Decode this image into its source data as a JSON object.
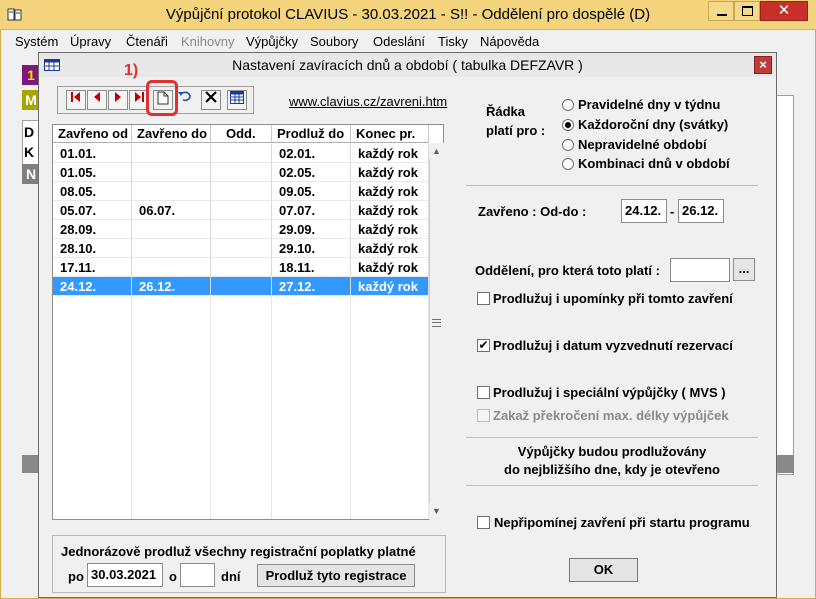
{
  "window": {
    "title": "Výpůjční protokol CLAVIUS - 30.03.2021 - S!! - Oddělení pro dospělé (D)"
  },
  "menu": [
    {
      "label": "Systém",
      "enabled": true
    },
    {
      "label": "Úpravy",
      "enabled": true
    },
    {
      "label": "Čtenáři",
      "enabled": true
    },
    {
      "label": "Knihovny",
      "enabled": false
    },
    {
      "label": "Výpůjčky",
      "enabled": true
    },
    {
      "label": "Soubory",
      "enabled": true
    },
    {
      "label": "Odeslání",
      "enabled": true
    },
    {
      "label": "Tisky",
      "enabled": true
    },
    {
      "label": "Nápověda",
      "enabled": true
    }
  ],
  "background_strip": [
    "1",
    "M",
    "D",
    "K",
    "N"
  ],
  "dialog": {
    "title": "Nastavení zavíracích dnů a období ( tabulka DEFZAVR )",
    "close": "×",
    "annotation": "1)",
    "link": "www.clavius.cz/zavreni.htm",
    "toolbar": [
      "first-record-icon",
      "prev-record-icon",
      "next-record-icon",
      "last-record-icon",
      "new-record-icon",
      "undo-icon",
      "delete-icon",
      "calendar-icon"
    ]
  },
  "table": {
    "headers": [
      "Zavřeno od",
      "Zavřeno do",
      "Odd.",
      "Prodluž do",
      "Konec pr."
    ],
    "rows": [
      [
        "01.01.",
        "",
        "",
        "02.01.",
        "každý rok"
      ],
      [
        "01.05.",
        "",
        "",
        "02.05.",
        "každý rok"
      ],
      [
        "08.05.",
        "",
        "",
        "09.05.",
        "každý rok"
      ],
      [
        "05.07.",
        "06.07.",
        "",
        "07.07.",
        "každý rok"
      ],
      [
        "28.09.",
        "",
        "",
        "29.09.",
        "každý rok"
      ],
      [
        "28.10.",
        "",
        "",
        "29.10.",
        "každý rok"
      ],
      [
        "17.11.",
        "",
        "",
        "18.11.",
        "každý rok"
      ],
      [
        "24.12.",
        "26.12.",
        "",
        "27.12.",
        "každý rok"
      ]
    ],
    "selected_row": 7
  },
  "bulk": {
    "text": "Jednorázově prodluž všechny registrační poplatky platné",
    "po_label": "po",
    "date": "30.03.2021",
    "o_label": "o",
    "days": "",
    "days_label": "dní",
    "button": "Prodluž tyto registrace"
  },
  "settings": {
    "row_label_1": "Řádka",
    "row_label_2": "platí pro :",
    "radios": [
      {
        "label": "Pravidelné dny v týdnu",
        "checked": false
      },
      {
        "label": "Každoroční dny (svátky)",
        "checked": true
      },
      {
        "label": "Nepravidelné období",
        "checked": false
      },
      {
        "label": "Kombinaci dnů v období",
        "checked": false
      }
    ],
    "closed_label": "Zavřeno : Od-do :",
    "closed_from": "24.12.",
    "dash": "-",
    "closed_to": "26.12.",
    "dept_label": "Oddělení, pro která toto platí :",
    "dept_value": "",
    "dept_button": "...",
    "checks": [
      {
        "label": "Prodlužuj i upomínky při tomto zavření",
        "checked": false,
        "enabled": true
      },
      {
        "label": "Prodlužuj i datum vyzvednutí rezervací",
        "checked": true,
        "enabled": true
      },
      {
        "label": "Prodlužuj i speciální výpůjčky ( MVS )",
        "checked": false,
        "enabled": true
      },
      {
        "label": "Zakaž překročení max. délky výpůjček",
        "checked": false,
        "enabled": false
      }
    ],
    "info_line1": "Výpůjčky budou prodlužovány",
    "info_line2": "do nejbližšího dne, kdy je otevřeno",
    "remind": {
      "label": "Nepřipomínej zavření při startu programu",
      "checked": false
    },
    "ok": "OK"
  }
}
